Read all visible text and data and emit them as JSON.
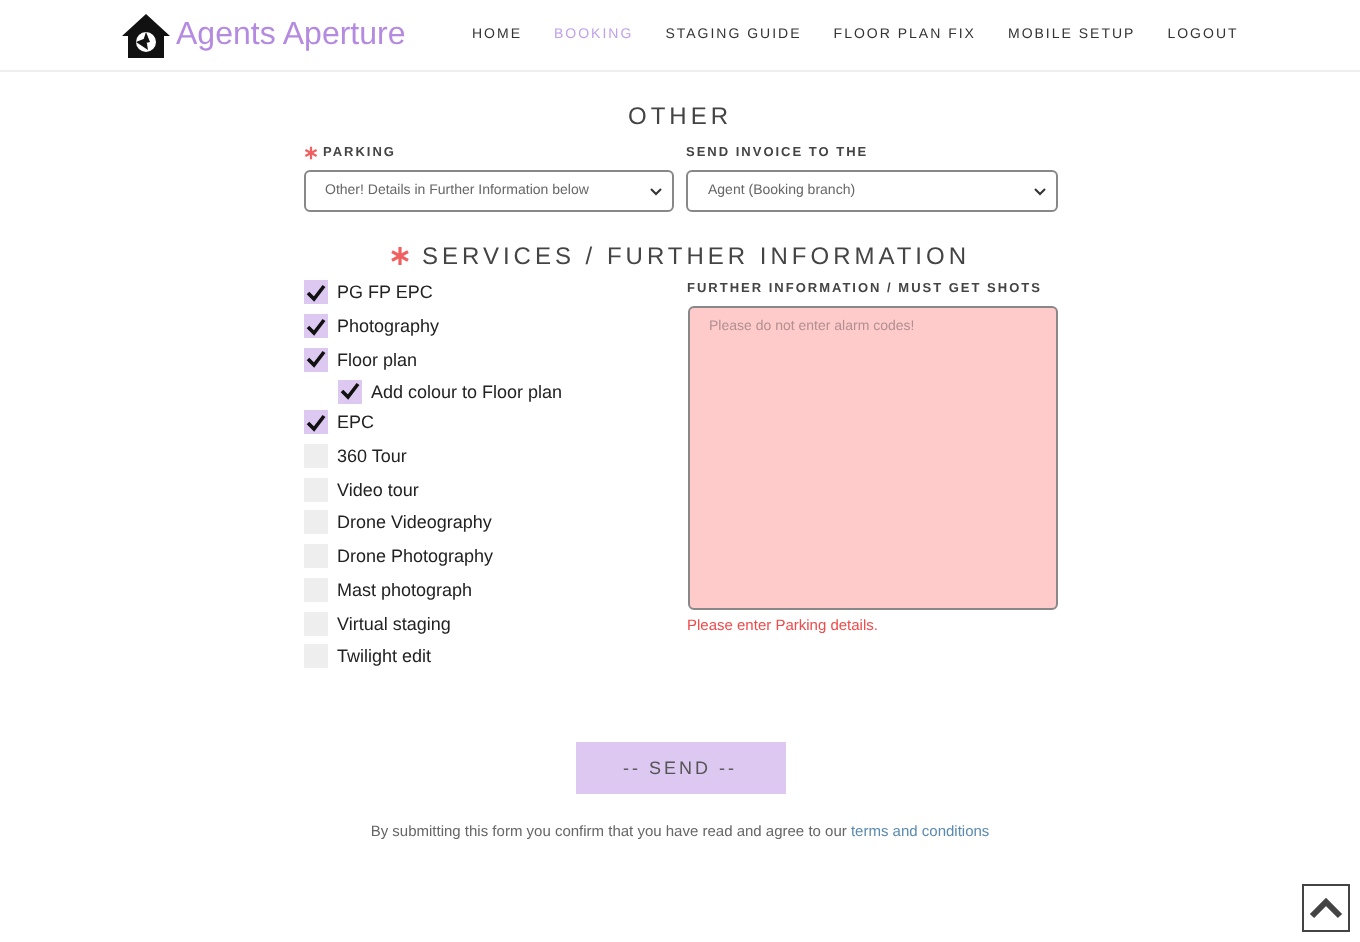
{
  "header": {
    "brand": "Agents Aperture",
    "nav": [
      {
        "label": "HOME",
        "selected": false
      },
      {
        "label": "BOOKING",
        "selected": true
      },
      {
        "label": "STAGING GUIDE",
        "selected": false
      },
      {
        "label": "FLOOR PLAN FIX",
        "selected": false
      },
      {
        "label": "MOBILE SETUP",
        "selected": false
      },
      {
        "label": "LOGOUT",
        "selected": false
      }
    ]
  },
  "section_title": "OTHER",
  "selects": [
    {
      "label": "PARKING",
      "required": true,
      "value": "Other! Details in Further Information below"
    },
    {
      "label": "SEND INVOICE TO THE",
      "required": false,
      "value": "Agent (Booking branch)"
    }
  ],
  "services": {
    "title": "SERVICES / FURTHER INFORMATION",
    "required": true,
    "items": [
      {
        "label": "PG FP EPC",
        "checked": true
      },
      {
        "label": "Photography",
        "checked": true
      },
      {
        "label": "Floor plan",
        "checked": true,
        "children": [
          {
            "label": "Add colour to Floor plan",
            "checked": true
          }
        ]
      },
      {
        "label": "EPC",
        "checked": true
      },
      {
        "label": "360 Tour",
        "checked": false
      },
      {
        "label": "Video tour",
        "checked": false
      },
      {
        "label": "Drone Videography",
        "checked": false
      },
      {
        "label": "Drone Photography",
        "checked": false
      },
      {
        "label": "Mast photograph",
        "checked": false
      },
      {
        "label": "Virtual staging",
        "checked": false
      },
      {
        "label": "Twilight edit",
        "checked": false
      }
    ]
  },
  "further_info": {
    "label": "FURTHER INFORMATION / MUST GET SHOTS",
    "placeholder": "Please do not enter alarm codes!",
    "invalid": true,
    "error": "Please enter Parking details."
  },
  "send_button": "-- SEND --",
  "consent": {
    "text": "By submitting this form you confirm that you have read and agree to our",
    "link": "terms and conditions"
  }
}
